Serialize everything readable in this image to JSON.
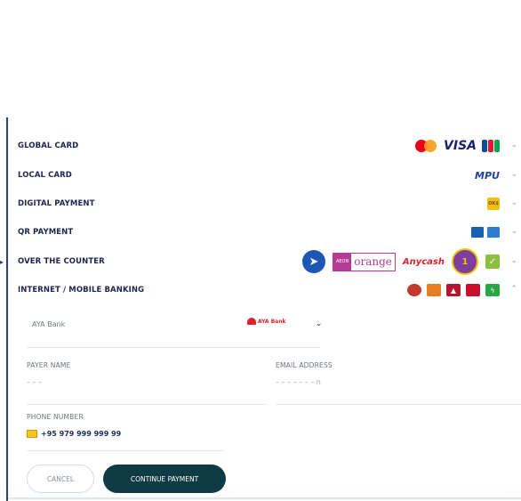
{
  "payment_methods": [
    {
      "label": "GLOBAL CARD",
      "logos": [
        "mastercard-logo",
        "visa-logo",
        "jcb-logo"
      ],
      "visa_text": "VISA",
      "expanded": false
    },
    {
      "label": "LOCAL CARD",
      "logos": [
        "mpu-logo"
      ],
      "mpu_text": "MPU",
      "expanded": false
    },
    {
      "label": "DIGITAL PAYMENT",
      "logos": [
        "okdollar-logo"
      ],
      "ok_text": "OK$",
      "expanded": false
    },
    {
      "label": "QR PAYMENT",
      "logos": [
        "qr-bank-logo-1",
        "qr-bank-logo-2"
      ],
      "expanded": false
    },
    {
      "label": "OVER THE COUNTER",
      "logos": [
        "blue-arrow-logo",
        "aeon-orange-logo",
        "anycash-logo",
        "one-stop-logo",
        "green-logo"
      ],
      "aeon_text": "AEON",
      "orange_text": "orange",
      "anycash_text": "Anycash",
      "expanded": false
    },
    {
      "label": "INTERNET / MOBILE BANKING",
      "logos": [
        "bank-logo-1",
        "bank-logo-2",
        "bank-logo-3",
        "bank-logo-4",
        "bank-logo-5"
      ],
      "expanded": true
    }
  ],
  "bank_select": {
    "value": "AYA Bank",
    "logo_text": "AYA Bank"
  },
  "form": {
    "payer_name_label": "PAYER NAME",
    "payer_name_value": "– – –",
    "email_label": "EMAIL ADDRESS",
    "email_value": "– – – – – – – n",
    "phone_label": "PHONE NUMBER",
    "phone_value": "+95 979 999 999 99"
  },
  "buttons": {
    "cancel": "CANCEL",
    "continue": "CONTINUE PAYMENT"
  },
  "colors": {
    "navy": "#1b2750",
    "continue_bg": "#103b45",
    "accent": "#2b3f78"
  }
}
